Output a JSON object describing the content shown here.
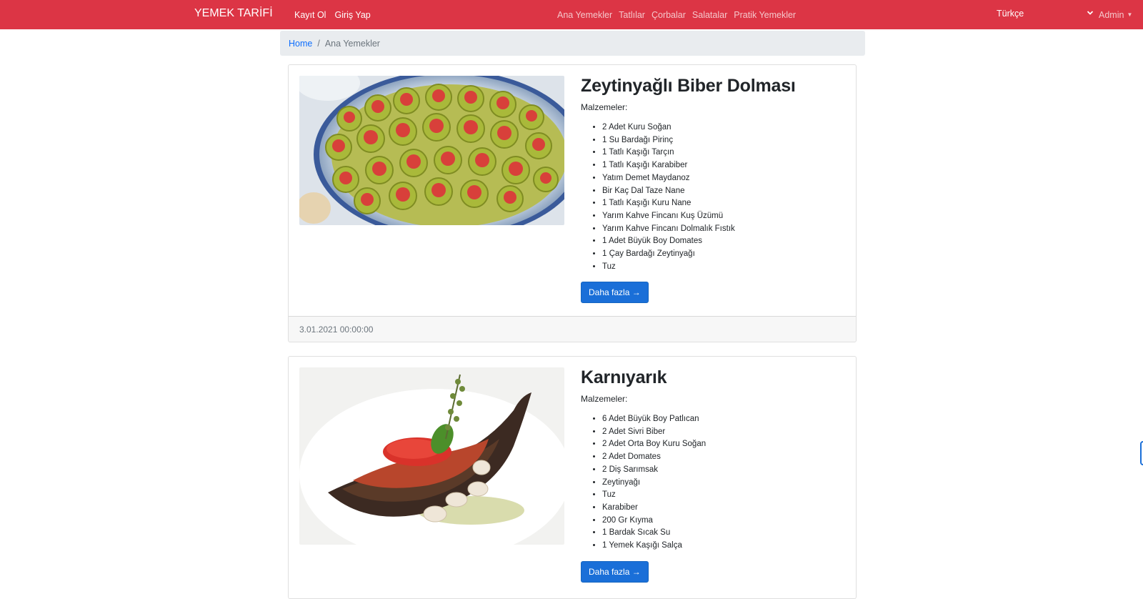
{
  "brand": "YEMEK TARİFİ",
  "auth_links": [
    "Kayıt Ol",
    "Giriş Yap"
  ],
  "categories": [
    "Ana Yemekler",
    "Tatlılar",
    "Çorbalar",
    "Salatalar",
    "Pratik Yemekler"
  ],
  "language": {
    "selected": "Türkçe"
  },
  "user_menu": "Admin",
  "breadcrumb": {
    "home": "Home",
    "separator": "/",
    "current": "Ana Yemekler"
  },
  "recipes": [
    {
      "title": "Zeytinyağlı Biber Dolması",
      "ingredients_label": "Malzemeler:",
      "ingredients": [
        "2 Adet Kuru Soğan",
        "1 Su Bardağı Pirinç",
        "1 Tatlı Kaşığı Tarçın",
        "1 Tatlı Kaşığı Karabiber",
        "Yatım Demet Maydanoz",
        "Bir Kaç Dal Taze Nane",
        "1 Tatlı Kaşığı Kuru Nane",
        "Yarım Kahve Fincanı Kuş Üzümü",
        "Yarım Kahve Fincanı Dolmalık Fıstık",
        "1 Adet Büyük Boy Domates",
        "1 Çay Bardağı Zeytinyağı",
        "Tuz"
      ],
      "button": "Daha fazla →",
      "date": "3.01.2021 00:00:00"
    },
    {
      "title": "Karnıyarık",
      "ingredients_label": "Malzemeler:",
      "ingredients": [
        "6 Adet Büyük Boy Patlıcan",
        "2 Adet Sivri Biber",
        "2 Adet Orta Boy Kuru Soğan",
        "2 Adet Domates",
        "2 Diş Sarımsak",
        "Zeytinyağı",
        "Tuz",
        "Karabiber",
        "200 Gr Kıyma",
        "1 Bardak Sıcak Su",
        "1 Yemek Kaşığı Salça"
      ],
      "button": "Daha fazla →"
    }
  ],
  "colors": {
    "navbar": "#dc3545",
    "primary_button": "#1a6fd8",
    "link": "#0d6efd"
  }
}
